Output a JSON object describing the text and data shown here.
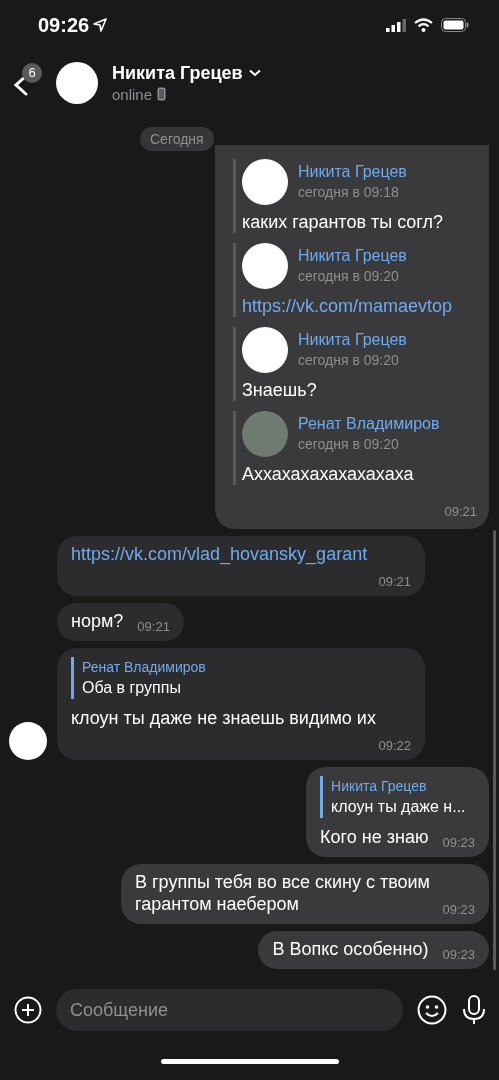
{
  "status_bar": {
    "time": "09:26"
  },
  "header": {
    "unread": "6",
    "name": "Никита Грецев",
    "status": "online"
  },
  "date_pill": "Сегодня",
  "messages": [
    {
      "kind": "forwarded",
      "outgoing": true,
      "time": "09:21",
      "forwards": [
        {
          "name": "Никита Грецев",
          "date": "сегодня в 09:18",
          "text": "каких гарантов ты согл?",
          "link": false,
          "photo_avatar": false
        },
        {
          "name": "Никита Грецев",
          "date": "сегодня в 09:20",
          "text": "https://vk.com/mamaevtop",
          "link": true,
          "photo_avatar": false
        },
        {
          "name": "Никита Грецев",
          "date": "сегодня в 09:20",
          "text": "Знаешь?",
          "link": false,
          "photo_avatar": false
        },
        {
          "name": "Ренат Владимиров",
          "date": "сегодня в 09:20",
          "text": "Аххахахахахахахаха",
          "link": false,
          "photo_avatar": true
        }
      ]
    },
    {
      "kind": "text",
      "outgoing": false,
      "text": "https://vk.com/vlad_hovansky_garant",
      "link": true,
      "time": "09:21",
      "avatar": false
    },
    {
      "kind": "text",
      "outgoing": false,
      "text": "норм?",
      "link": false,
      "time": "09:21",
      "avatar": false
    },
    {
      "kind": "reply",
      "outgoing": false,
      "reply_name": "Ренат Владимиров",
      "reply_text": "Оба в группы",
      "text": "клоун ты даже не знаешь видимо их",
      "link": false,
      "time": "09:22",
      "avatar": true
    },
    {
      "kind": "reply",
      "outgoing": true,
      "reply_name": "Никита Грецев",
      "reply_text": "клоун ты даже н...",
      "text": "Кого не знаю",
      "link": false,
      "time": "09:23"
    },
    {
      "kind": "text",
      "outgoing": true,
      "text": "В группы тебя во все скину с твоим гарантом наебером",
      "link": false,
      "time": "09:23"
    },
    {
      "kind": "text",
      "outgoing": true,
      "text": "В Вопкс особенно)",
      "link": false,
      "time": "09:23"
    }
  ],
  "composer": {
    "placeholder": "Сообщение"
  }
}
